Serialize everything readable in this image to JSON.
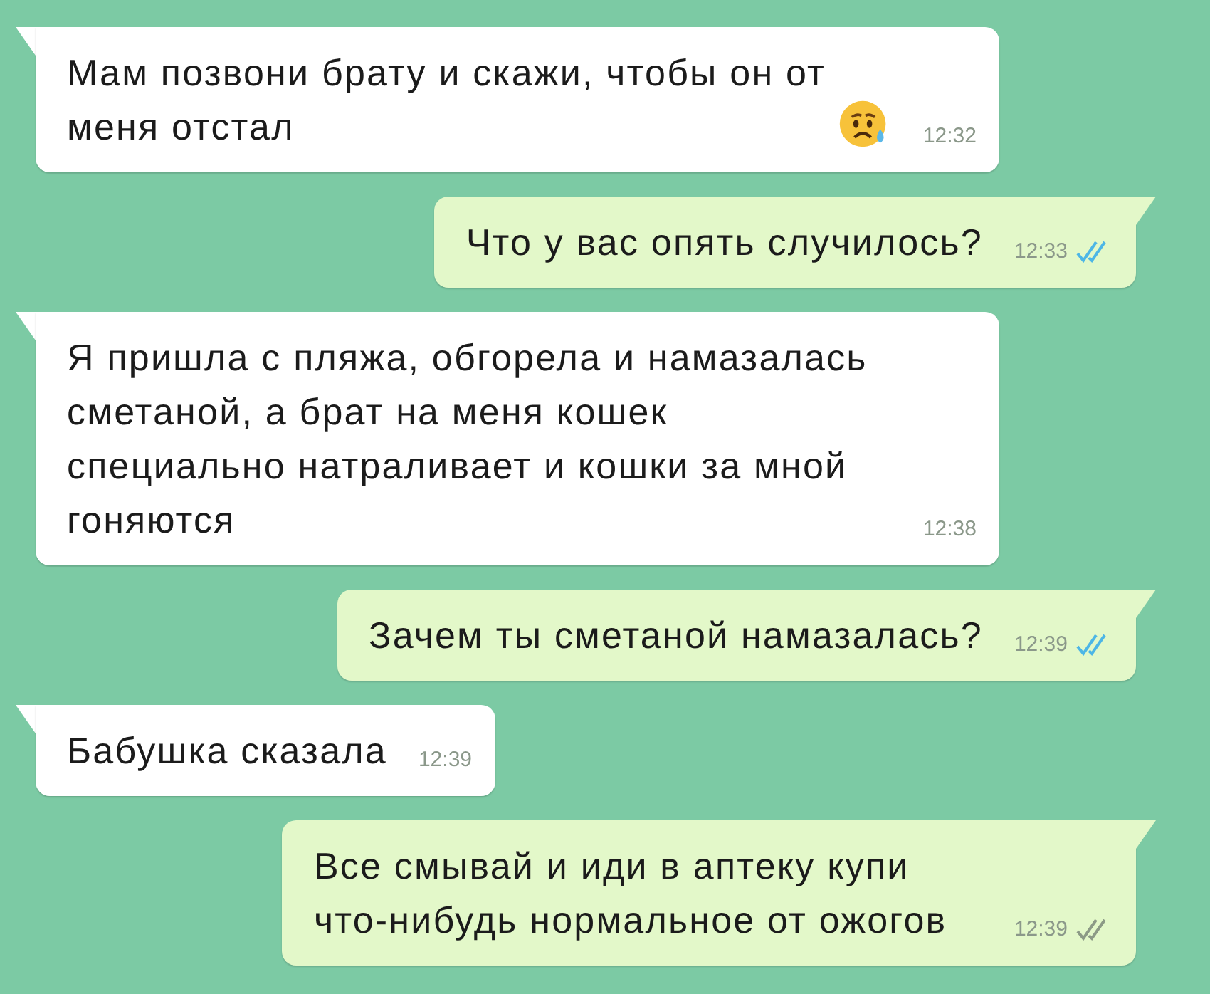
{
  "messages": [
    {
      "kind": "incoming",
      "text": "Мам позвони брату и скажи, чтобы он от меня отстал",
      "emoji": {
        "kind": "sad-sweat"
      },
      "time": "12:32"
    },
    {
      "kind": "outgoing",
      "text": "Что у вас опять случилось?",
      "time": "12:33",
      "read": true
    },
    {
      "kind": "incoming",
      "text": "Я пришла с пляжа, обгорела и намазалась сметаной, а брат на меня кошек специально натраливает и кошки за мной гоняются",
      "time": "12:38"
    },
    {
      "kind": "outgoing",
      "text": "Зачем ты сметаной намазалась?",
      "time": "12:39",
      "read": true
    },
    {
      "kind": "incoming",
      "text": "Бабушка сказала",
      "time": "12:39"
    },
    {
      "kind": "outgoing",
      "text": "Все смывай и иди в аптеку купи что-нибудь нормальное от ожогов",
      "time": "12:39",
      "read": false
    }
  ]
}
